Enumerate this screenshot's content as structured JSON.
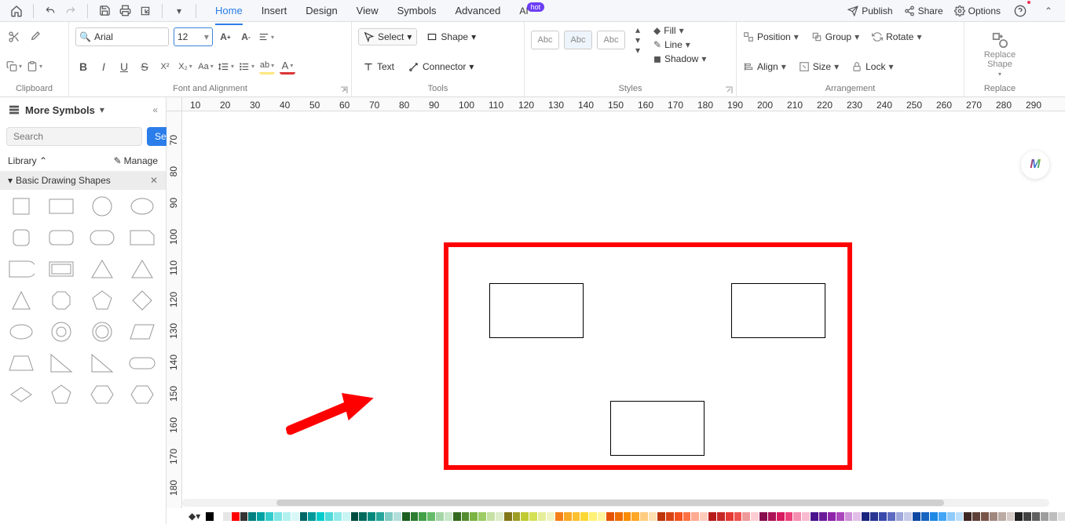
{
  "topbar": {
    "menu": [
      "Home",
      "Insert",
      "Design",
      "View",
      "Symbols",
      "Advanced",
      "AI"
    ],
    "ai_badge": "hot",
    "publish": "Publish",
    "share": "Share",
    "options": "Options"
  },
  "ribbon": {
    "clipboard": {
      "label": "Clipboard"
    },
    "font": {
      "name": "Arial",
      "size": "12",
      "label": "Font and Alignment"
    },
    "tools": {
      "select": "Select",
      "shape": "Shape",
      "text": "Text",
      "connector": "Connector",
      "label": "Tools"
    },
    "styles": {
      "pill": "Abc",
      "label": "Styles",
      "fill": "Fill",
      "line": "Line",
      "shadow": "Shadow"
    },
    "arrange": {
      "position": "Position",
      "group": "Group",
      "rotate": "Rotate",
      "align": "Align",
      "size": "Size",
      "lock": "Lock",
      "label": "Arrangement"
    },
    "replace": {
      "title": "Replace Shape",
      "label": "Replace"
    }
  },
  "sidebar": {
    "title": "More Symbols",
    "search_ph": "Search",
    "search_btn": "Search",
    "library": "Library",
    "manage": "Manage",
    "category": "Basic Drawing Shapes"
  },
  "ruler_h": [
    10,
    20,
    30,
    40,
    50,
    60,
    70,
    80,
    90,
    100,
    110,
    120,
    130,
    140,
    150,
    160,
    170,
    180,
    190,
    200,
    210,
    220,
    230,
    240,
    250,
    260,
    270,
    280,
    290
  ],
  "ruler_v": [
    70,
    80,
    90,
    100,
    110,
    120,
    130,
    140,
    150,
    160,
    170,
    180
  ],
  "palette": [
    "#000000",
    "#ffffff",
    "#e6e6e6",
    "#ff0000",
    "#343434",
    "#008080",
    "#00a2a2",
    "#33cccc",
    "#80e5e5",
    "#b3f0f0",
    "#d9f7f7",
    "#006666",
    "#009999",
    "#00cccc",
    "#4edada",
    "#91eaea",
    "#c8f4f4",
    "#004d40",
    "#00695c",
    "#00897b",
    "#26a69a",
    "#80cbc4",
    "#b2dfdb",
    "#1b5e20",
    "#2e7d32",
    "#43a047",
    "#66bb6a",
    "#a5d6a7",
    "#c8e6c9",
    "#33691e",
    "#558b2f",
    "#7cb342",
    "#9ccc65",
    "#c5e1a5",
    "#dcedc8",
    "#827717",
    "#9e9d24",
    "#c0ca33",
    "#d4e157",
    "#e6ee9c",
    "#f0f4c3",
    "#f57f17",
    "#f9a825",
    "#fbc02d",
    "#fdd835",
    "#fff176",
    "#fff59d",
    "#e65100",
    "#ef6c00",
    "#fb8c00",
    "#ffa726",
    "#ffcc80",
    "#ffe0b2",
    "#bf360c",
    "#d84315",
    "#f4511e",
    "#ff7043",
    "#ffab91",
    "#ffccbc",
    "#b71c1c",
    "#c62828",
    "#e53935",
    "#ef5350",
    "#ef9a9a",
    "#ffcdd2",
    "#880e4f",
    "#ad1457",
    "#d81b60",
    "#ec407a",
    "#f48fb1",
    "#f8bbd0",
    "#4a148c",
    "#6a1b9a",
    "#8e24aa",
    "#ab47bc",
    "#ce93d8",
    "#e1bee7",
    "#1a237e",
    "#283593",
    "#3949ab",
    "#5c6bc0",
    "#9fa8da",
    "#c5cae9",
    "#0d47a1",
    "#1565c0",
    "#1e88e5",
    "#42a5f5",
    "#90caf9",
    "#bbdefb",
    "#3e2723",
    "#5d4037",
    "#795548",
    "#a1887f",
    "#bcaaa4",
    "#d7ccc8",
    "#212121",
    "#424242",
    "#616161",
    "#9e9e9e",
    "#bdbdbd",
    "#e0e0e0"
  ]
}
